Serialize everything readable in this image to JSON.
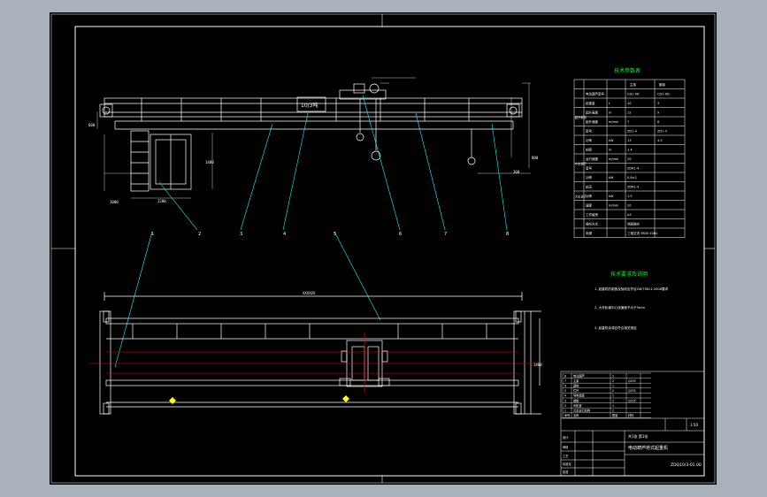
{
  "drawing": {
    "crane_label": "10/3吨",
    "callouts": [
      "1",
      "2",
      "3",
      "4",
      "5",
      "6",
      "7",
      "8"
    ],
    "span_dim": "XXXXXX",
    "colors": {
      "background": "#a9b1bb",
      "sheet": "#000000",
      "lines": "#ffffff",
      "leaders": "#00ffff",
      "center_lines": "#ff0000",
      "headers": "#00ff00",
      "markers": "#ffff00"
    }
  },
  "spec_table": {
    "title": "技术参数表",
    "col_headers": [
      "主钩",
      "副钩"
    ],
    "group_labels": [
      "起升机构",
      "小车运行",
      "大车运行"
    ],
    "rows": [
      {
        "label": "电动葫芦型号",
        "unit": "",
        "main": "CD1-9D",
        "aux": "CD1-9D"
      },
      {
        "label": "起重量",
        "unit": "t",
        "main": "10",
        "aux": "3"
      },
      {
        "label": "起升高度",
        "unit": "m",
        "main": "12",
        "aux": "9"
      },
      {
        "label": "起升速度",
        "unit": "m/min",
        "main": "7",
        "aux": "8"
      },
      {
        "label": "型号",
        "unit": "",
        "main": "ZD1-4",
        "aux": "ZD1-4"
      },
      {
        "label": "功率",
        "unit": "kW",
        "main": "13",
        "aux": "4.5"
      },
      {
        "label": "轮距",
        "unit": "m",
        "main": "1.4",
        "aux": ""
      },
      {
        "label": "运行速度",
        "unit": "m/min",
        "main": "20",
        "aux": ""
      },
      {
        "label": "型号",
        "unit": "",
        "main": "ZDR1-4",
        "aux": ""
      },
      {
        "label": "功率",
        "unit": "kW",
        "main": "0.8×2",
        "aux": ""
      },
      {
        "label": "轮压",
        "unit": "",
        "main": "ZDR1-4",
        "aux": ""
      },
      {
        "label": "功率",
        "unit": "kW",
        "main": "1.5",
        "aux": ""
      },
      {
        "label": "速度",
        "unit": "m/min",
        "main": "20",
        "aux": ""
      },
      {
        "label": "工作级别",
        "unit": "",
        "main": "A3",
        "aux": ""
      },
      {
        "label": "操纵方式",
        "unit": "",
        "main": "地面操纵",
        "aux": ""
      },
      {
        "label": "电源",
        "unit": "",
        "main": "三相交流 380V 50Hz",
        "aux": ""
      }
    ]
  },
  "tech_notes": {
    "title": "技术要求及说明",
    "items": [
      "1. 起重机的制造及验收应符合GB/T3811-2008要求",
      "2. 大车轨道中心线偏差不大于5mm",
      "3. 起重机涂漆应符合相关规定"
    ]
  },
  "title_block": {
    "drawing_title": "电动葫芦桥式起重机",
    "drawing_number": "ZDQ10/3-01.00",
    "scale": "1:50",
    "sheet": "共1张 第1张",
    "signature_labels": [
      "设计",
      "审核",
      "工艺",
      "标准化",
      "批准"
    ],
    "parts": [
      {
        "no": "8",
        "name": "电动葫芦",
        "qty": "1",
        "material": ""
      },
      {
        "no": "7",
        "name": "主梁",
        "qty": "2",
        "material": "Q235"
      },
      {
        "no": "6",
        "name": "副钩",
        "qty": "1",
        "material": ""
      },
      {
        "no": "5",
        "name": "栏杆",
        "qty": "2",
        "material": "Q235"
      },
      {
        "no": "4",
        "name": "导电装置",
        "qty": "1",
        "material": ""
      },
      {
        "no": "3",
        "name": "端梁",
        "qty": "2",
        "material": "Q235"
      },
      {
        "no": "2",
        "name": "司机室",
        "qty": "1",
        "material": ""
      },
      {
        "no": "1",
        "name": "大车运行机构",
        "qty": "2",
        "material": ""
      }
    ],
    "headers": [
      "序号",
      "名称",
      "数量",
      "材料"
    ]
  }
}
